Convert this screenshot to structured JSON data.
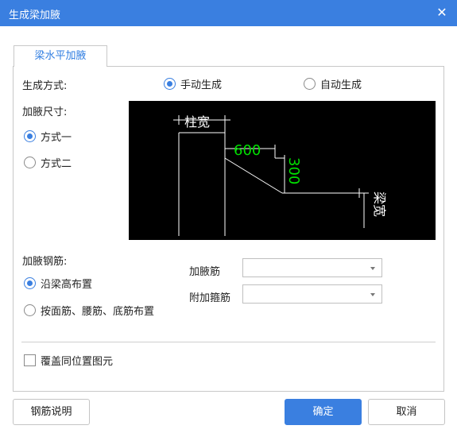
{
  "window": {
    "title": "生成梁加腋",
    "close_icon": "close-icon"
  },
  "tab": {
    "label": "梁水平加腋"
  },
  "generation": {
    "label": "生成方式:",
    "options": [
      {
        "label": "手动生成",
        "selected": true
      },
      {
        "label": "自动生成",
        "selected": false
      }
    ]
  },
  "size": {
    "label": "加腋尺寸:",
    "options": [
      {
        "label": "方式一",
        "selected": true
      },
      {
        "label": "方式二",
        "selected": false
      }
    ]
  },
  "preview": {
    "column_width_label": "柱宽",
    "dim_600": "600",
    "dim_300": "300",
    "beam_width_label": "梁宽",
    "dim_color": "#00e000",
    "line_color": "#ffffff",
    "bg_color": "#000000"
  },
  "rebar": {
    "label": "加腋钢筋:",
    "options": [
      {
        "label": "沿梁高布置",
        "selected": true
      },
      {
        "label": "按面筋、腰筋、底筋布置",
        "selected": false
      }
    ],
    "haunch_rebar": {
      "label": "加腋筋",
      "value": ""
    },
    "stirrup": {
      "label": "附加箍筋",
      "value": ""
    }
  },
  "override": {
    "label": "覆盖同位置图元",
    "checked": false
  },
  "buttons": {
    "help": "钢筋说明",
    "ok": "确定",
    "cancel": "取消"
  },
  "colors": {
    "accent": "#3a7fe0"
  }
}
